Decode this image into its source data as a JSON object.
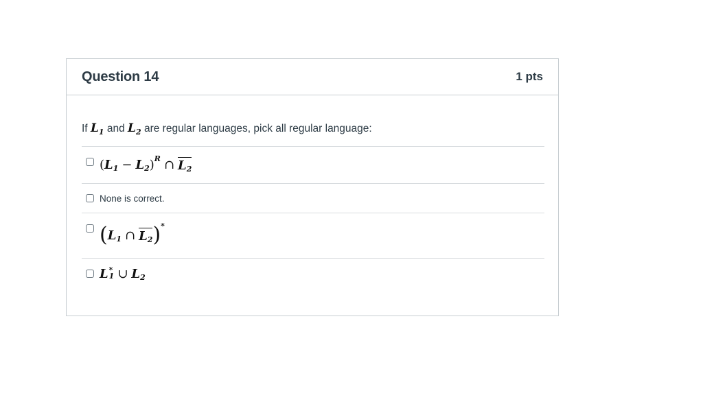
{
  "question": {
    "title": "Question 14",
    "points": "1 pts"
  },
  "prompt": {
    "prefix": "If",
    "var1": "L",
    "var1_sub": "1",
    "conj": "and",
    "var2": "L",
    "var2_sub": "2",
    "suffix": "are regular languages, pick all regular language:"
  },
  "answers": [
    {
      "type": "math",
      "expression": "(L1 − L2)^R ∩ complement(L2)",
      "parts": {
        "open": "(",
        "l1": "L",
        "l1_sub": "1",
        "minus": "−",
        "l2": "L",
        "l2_sub": "2",
        "close": ")",
        "sup": "R",
        "cap": "∩",
        "l2bar": "L",
        "l2bar_sub": "2"
      }
    },
    {
      "type": "text",
      "label": "None is correct."
    },
    {
      "type": "math",
      "expression": "(L1 ∩ complement(L2))*",
      "parts": {
        "open": "(",
        "l1": "L",
        "l1_sub": "1",
        "cap": "∩",
        "l2bar": "L",
        "l2bar_sub": "2",
        "close": ")",
        "sup": "*"
      }
    },
    {
      "type": "math",
      "expression": "L1* ∪ L2",
      "parts": {
        "l1": "L",
        "l1_sub": "1",
        "l1_sup": "*",
        "cup": "∪",
        "l2": "L",
        "l2_sub": "2"
      }
    }
  ]
}
